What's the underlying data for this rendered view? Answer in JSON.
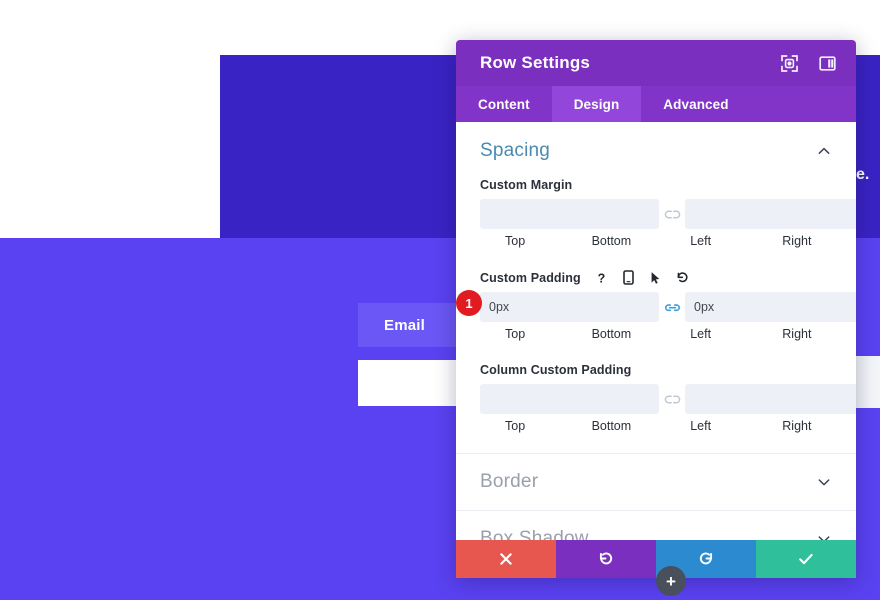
{
  "background": {
    "email_label": "Email",
    "edge_text": "e.",
    "colors": {
      "dark_block": "#3a23c4",
      "purple_band": "#5a42f2",
      "email_chip": "#6a57f5"
    }
  },
  "modal": {
    "title": "Row Settings",
    "titlebar_icons": [
      {
        "name": "fullscreen-icon",
        "label": "Expand"
      },
      {
        "name": "layout-columns-icon",
        "label": "Change layout"
      }
    ],
    "tabs": [
      {
        "label": "Content",
        "active": false
      },
      {
        "label": "Design",
        "active": true
      },
      {
        "label": "Advanced",
        "active": false
      }
    ],
    "sections": [
      {
        "name": "spacing",
        "title": "Spacing",
        "expanded": true,
        "toggle_icon": "chevron-up-icon",
        "groups": [
          {
            "name": "custom-margin",
            "label": "Custom Margin",
            "badge": null,
            "label_icons": [],
            "link_left": "unlink-icon",
            "link_right": "unlink-icon",
            "fields": [
              {
                "caption": "Top",
                "value": "",
                "placeholder": ""
              },
              {
                "caption": "Bottom",
                "value": "",
                "placeholder": ""
              },
              {
                "caption": "Left",
                "value": "",
                "placeholder": ""
              },
              {
                "caption": "Right",
                "value": "",
                "placeholder": ""
              }
            ]
          },
          {
            "name": "custom-padding",
            "label": "Custom Padding",
            "badge": "1",
            "label_icons": [
              {
                "name": "help-icon",
                "glyph": "?"
              },
              {
                "name": "mobile-icon",
                "glyph": ""
              },
              {
                "name": "cursor-icon",
                "glyph": ""
              },
              {
                "name": "reset-icon",
                "glyph": ""
              }
            ],
            "link_left": "link-icon",
            "link_right": "unlink-icon",
            "fields": [
              {
                "caption": "Top",
                "value": "0px",
                "placeholder": ""
              },
              {
                "caption": "Bottom",
                "value": "0px",
                "placeholder": ""
              },
              {
                "caption": "Left",
                "value": "",
                "placeholder": ""
              },
              {
                "caption": "Right",
                "value": "",
                "placeholder": ""
              }
            ]
          },
          {
            "name": "column-custom-padding",
            "label": "Column Custom Padding",
            "badge": null,
            "label_icons": [],
            "link_left": "unlink-icon",
            "link_right": "unlink-icon",
            "fields": [
              {
                "caption": "Top",
                "value": "",
                "placeholder": ""
              },
              {
                "caption": "Bottom",
                "value": "",
                "placeholder": ""
              },
              {
                "caption": "Left",
                "value": "",
                "placeholder": ""
              },
              {
                "caption": "Right",
                "value": "",
                "placeholder": ""
              }
            ]
          }
        ]
      },
      {
        "name": "border",
        "title": "Border",
        "expanded": false,
        "toggle_icon": "chevron-down-icon"
      },
      {
        "name": "box-shadow",
        "title": "Box Shadow",
        "expanded": false,
        "toggle_icon": "chevron-down-icon"
      }
    ],
    "footer": [
      {
        "name": "cancel-button",
        "icon": "close-icon",
        "color": "#e7564f"
      },
      {
        "name": "undo-button",
        "icon": "undo-icon",
        "color": "#7b2fbe"
      },
      {
        "name": "redo-button",
        "icon": "redo-icon",
        "color": "#2b8ad0"
      },
      {
        "name": "save-button",
        "icon": "checkmark-icon",
        "color": "#2fbf9a"
      }
    ]
  },
  "fab": {
    "label": "+",
    "name": "add-section-button"
  }
}
